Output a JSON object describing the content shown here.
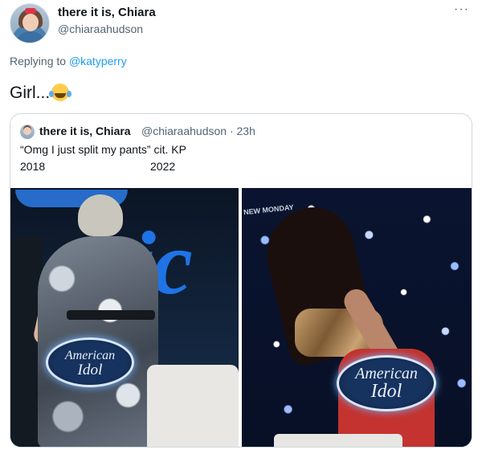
{
  "author": {
    "display_name": "there it is, Chiara",
    "handle": "@chiaraahudson",
    "avatar_icon": "profile-avatar"
  },
  "more_icon_glyph": "···",
  "replying": {
    "prefix": "Replying to",
    "mention": "@katyperry"
  },
  "tweet": {
    "text": "Girl...",
    "emoji_icon": "tears-of-joy-emoji"
  },
  "quote": {
    "display_name": "there it is, Chiara",
    "meta": "@chiaraahudson · 23h",
    "line1": "“Omg I just split my pants” cit. KP",
    "year_left": "2018",
    "year_right": "2022"
  },
  "media": {
    "left_badge": {
      "line1": "American",
      "line2": "Idol"
    },
    "right_badge": {
      "line1": "American",
      "line2": "Idol"
    },
    "right_overlay": "NEW MONDAY",
    "colors": {
      "stage_blue": "#1e74e6",
      "pants_red": "#c4332f"
    }
  },
  "colors": {
    "link": "#1d9bf0",
    "secondary_text": "#536471",
    "primary_text": "#0f1419",
    "border": "#cfd9de"
  }
}
